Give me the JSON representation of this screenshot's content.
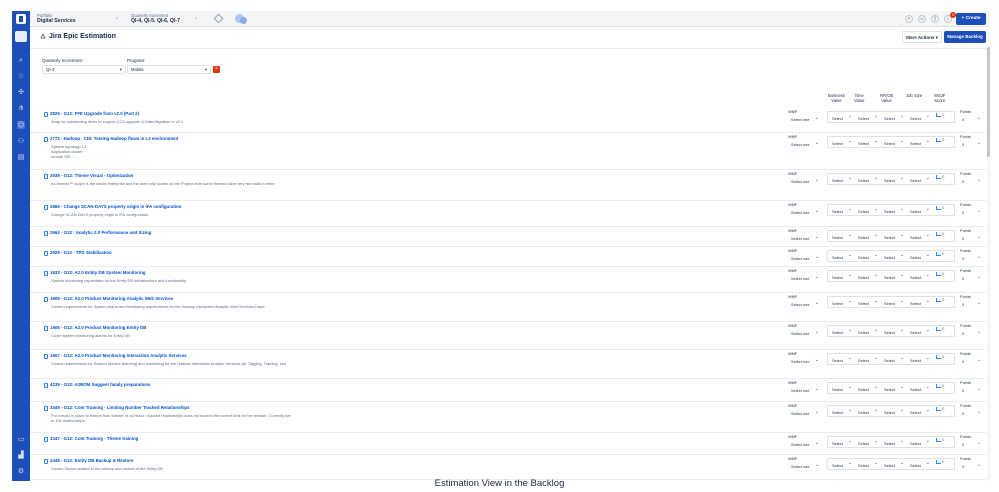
{
  "topbar": {
    "portfolio_label": "Portfolio",
    "portfolio_value": "Digital Services",
    "qi_label": "Quarterly Increment",
    "qi_value": "QI-4, QI-5, QI-6, QI-7",
    "create_label": "Create",
    "notification_count": "1"
  },
  "page": {
    "title": "Jira Epic Estimation",
    "more_actions": "More Actions",
    "manage_backlog": "Manage Backlog"
  },
  "filters": {
    "qi_label": "Quarterly Increment:",
    "qi_value": "QI-4",
    "program_label": "Program:",
    "program_value": "Mobile"
  },
  "columns": {
    "business_value": [
      "Business",
      "Value"
    ],
    "time_value": [
      "Time",
      "Value"
    ],
    "rroe_value": [
      "RR/OE",
      "Value"
    ],
    "job_size": [
      "Job Size",
      ""
    ],
    "wsjf_score": [
      "WSJF",
      "Score"
    ]
  },
  "row_labels": {
    "wmf": "WMF",
    "select_one": "Select one",
    "select": "Select",
    "points": "Points",
    "points_value": "0",
    "wsjf_value": "0"
  },
  "epics": [
    {
      "title": "2825 - G12: FFE Upgrade from v2.0 (Part 2)",
      "desc": "Wrap up outstanding items to support CCS upgrade & Data Migration to v2.1"
    },
    {
      "title": "2772 - Hadoop _CDI: Testing Hadoop flows in L3 environment",
      "desc": "System topology: L3\nApplication cluster\nremote SSL..."
    },
    {
      "title": "2939 - G12: Theme Visual - Optimization",
      "desc": "As themes™ scope is the whole enterprise and the user only scores as the Project level some themes have very few calls in them."
    },
    {
      "title": "2866 - Change SCAN-DAYS property origin in IFA configuration",
      "desc": "Change SCAN-DAYS property origin in IFA configuration."
    },
    {
      "title": "2664 - G12 : Analytic 2.0 Performance and Sizing",
      "desc": ""
    },
    {
      "title": "2929 - G12 - TRS Stabilization",
      "desc": ""
    },
    {
      "title": "1633 - G12: A2.0 Entity DB System Monitoring",
      "desc": "System Monitoring capabilities for the Entity DB infrastructure and functionality."
    },
    {
      "title": "1608 - G12: A2.0 Product Monitoring Analytic Web Services",
      "desc": "Covers requirements for System Alarm and Monitoring requirements for the Hadoop Interaction Analytic Web Services Layer."
    },
    {
      "title": "1606 - G12: A2.0 Product Monitoring Entity DB",
      "desc": "Cover system monitoring alarms for Entity DB"
    },
    {
      "title": "1607 - G12: A2.0 Product Monitoring Interaction Analytic Services",
      "desc": "Covers requirements for System Monitor Alarming and monitoring for the Hadoop Interaction Analytic Services (ie: Tagging, Training, etc)."
    },
    {
      "title": "4239 - G12: A2BOM Suggest family preparations",
      "desc": ""
    },
    {
      "title": "3349 - G12: Cont Training - Limiting Number Tracked Relationships",
      "desc": "Put checks in place to ensure that number of our/track / tracked relationships does not exceed the current limit for the release. Currently set to 10k relationships."
    },
    {
      "title": "3347 - G12: Cont Training - Theme training",
      "desc": ""
    },
    {
      "title": "2449 - G12: Entity DB Backup & Restore",
      "desc": "Covers Stories related to the backup and restore of the Entity DB"
    }
  ],
  "caption": "Estimation View in the Backlog"
}
